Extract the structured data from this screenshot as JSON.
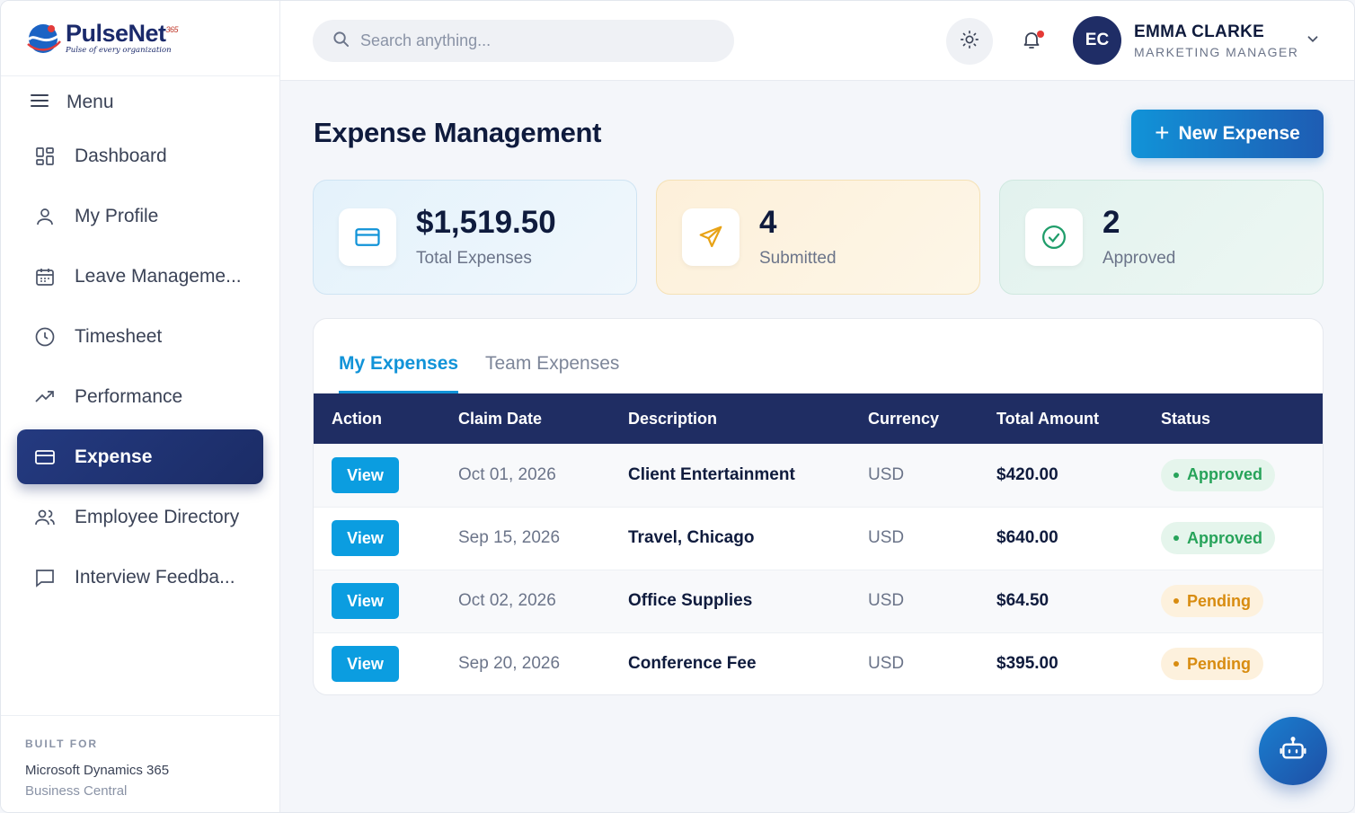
{
  "brand": {
    "name": "PulseNet",
    "sup": "365",
    "tagline": "Pulse of every organization"
  },
  "sidebar": {
    "menu_label": "Menu",
    "items": [
      {
        "label": "Dashboard",
        "icon": "grid-icon"
      },
      {
        "label": "My Profile",
        "icon": "user-icon"
      },
      {
        "label": "Leave Manageme...",
        "icon": "calendar-icon"
      },
      {
        "label": "Timesheet",
        "icon": "clock-icon"
      },
      {
        "label": "Performance",
        "icon": "trend-up-icon"
      },
      {
        "label": "Expense",
        "icon": "credit-card-icon",
        "active": true
      },
      {
        "label": "Employee Directory",
        "icon": "users-icon"
      },
      {
        "label": "Interview Feedba...",
        "icon": "message-icon"
      }
    ],
    "built_for_label": "BUILT FOR",
    "built_for_name": "Microsoft Dynamics 365",
    "built_for_sub": "Business Central"
  },
  "header": {
    "search_placeholder": "Search anything...",
    "user_initials": "EC",
    "user_name": "EMMA CLARKE",
    "user_role": "MARKETING MANAGER"
  },
  "page": {
    "title": "Expense Management",
    "new_button": "New Expense"
  },
  "stats": [
    {
      "value": "$1,519.50",
      "label": "Total Expenses",
      "icon": "credit-card-icon"
    },
    {
      "value": "4",
      "label": "Submitted",
      "icon": "send-icon"
    },
    {
      "value": "2",
      "label": "Approved",
      "icon": "check-circle-icon"
    }
  ],
  "tabs": [
    {
      "label": "My Expenses",
      "active": true
    },
    {
      "label": "Team Expenses",
      "active": false
    }
  ],
  "table": {
    "headers": [
      "Action",
      "Claim Date",
      "Description",
      "Currency",
      "Total Amount",
      "Status"
    ],
    "rows": [
      {
        "action": "View",
        "date": "Oct 01, 2026",
        "desc": "Client Entertainment",
        "currency": "USD",
        "amount": "$420.00",
        "status": "Approved"
      },
      {
        "action": "View",
        "date": "Sep 15, 2026",
        "desc": "Travel, Chicago",
        "currency": "USD",
        "amount": "$640.00",
        "status": "Approved"
      },
      {
        "action": "View",
        "date": "Oct 02, 2026",
        "desc": "Office Supplies",
        "currency": "USD",
        "amount": "$64.50",
        "status": "Pending"
      },
      {
        "action": "View",
        "date": "Sep 20, 2026",
        "desc": "Conference Fee",
        "currency": "USD",
        "amount": "$395.00",
        "status": "Pending"
      }
    ]
  },
  "colors": {
    "navy": "#1f2d63",
    "accent": "#1193d8",
    "approved": "#27a35a",
    "pending": "#d88c10"
  }
}
